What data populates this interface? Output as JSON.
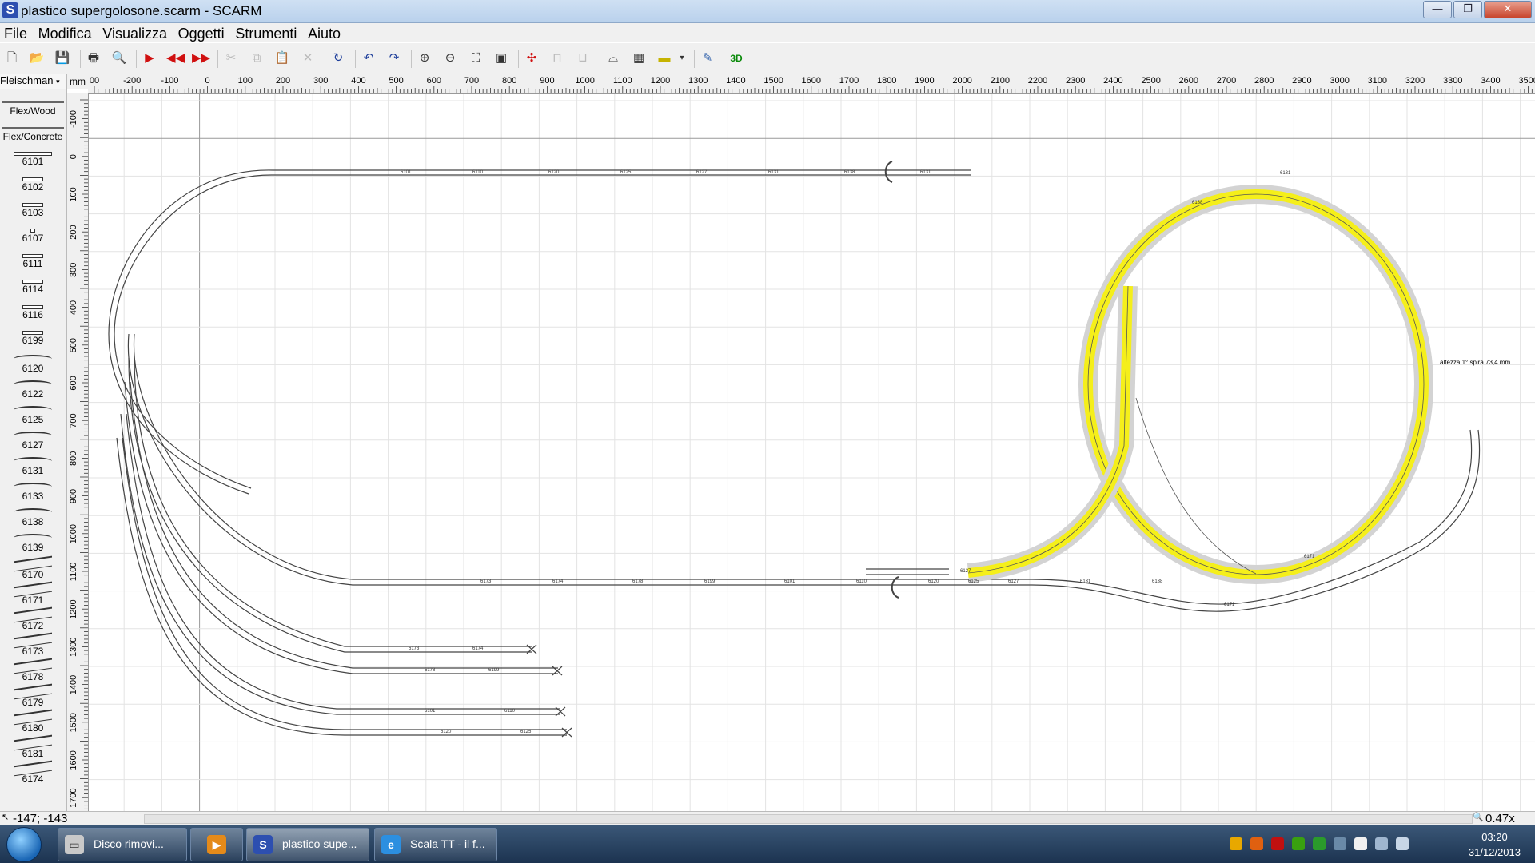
{
  "window": {
    "title": "plastico supergolosone.scarm - SCARM",
    "app_icon": "S",
    "minimize": "—",
    "maximize": "❐",
    "close": "✕"
  },
  "menu": [
    "File",
    "Modifica",
    "Visualizza",
    "Oggetti",
    "Strumenti",
    "Aiuto"
  ],
  "toolbar": {
    "icons": [
      "new-file-icon",
      "open-folder-icon",
      "save-icon",
      "print-icon",
      "print-preview-icon",
      "play-icon",
      "rewind-icon",
      "fast-forward-icon",
      "cut-icon",
      "copy-icon",
      "paste-icon",
      "delete-icon",
      "rotate-icon",
      "undo-icon",
      "redo-icon",
      "zoom-in-icon",
      "zoom-out-icon",
      "zoom-fit-icon",
      "zoom-100-icon",
      "track-split-icon",
      "track-join-icon",
      "track-flip-icon",
      "bridge-icon",
      "tunnel-icon",
      "layer-icon",
      "measure-icon",
      "3d-view-icon"
    ],
    "label_3d": "3D"
  },
  "palette": {
    "library": "Fleischman",
    "categories": [
      "Flex/Wood",
      "Flex/Concrete"
    ],
    "items": [
      "6101",
      "6102",
      "6103",
      "6107",
      "6111",
      "6114",
      "6116",
      "6199",
      "6120",
      "6122",
      "6125",
      "6127",
      "6131",
      "6133",
      "6138",
      "6139",
      "6170",
      "6171",
      "6172",
      "6173",
      "6178",
      "6179",
      "6180",
      "6181",
      "6174"
    ]
  },
  "ruler": {
    "unit": "mm",
    "h_labels": [
      "00",
      "-200",
      "-100",
      "0",
      "100",
      "200",
      "300",
      "400",
      "500",
      "600",
      "700",
      "800",
      "900",
      "1000",
      "1100",
      "1200",
      "1300",
      "1400",
      "1500",
      "1600",
      "1700",
      "1800",
      "1900",
      "2000",
      "2100",
      "2200",
      "2300",
      "2400",
      "2500",
      "2600",
      "2700",
      "2800",
      "2900",
      "3000",
      "3100",
      "3200",
      "3300",
      "3400",
      "3500"
    ],
    "v_labels": [
      "-100",
      "0",
      "100",
      "200",
      "300",
      "400",
      "500",
      "600",
      "700",
      "800",
      "900",
      "1000",
      "1100",
      "1200",
      "1300",
      "1400",
      "1500",
      "1600",
      "1700"
    ]
  },
  "canvas": {
    "annotation": "altezza 1° spira 73,4 mm",
    "track_labels": [
      "6101",
      "6110",
      "6120",
      "6125",
      "6127",
      "6131",
      "6138",
      "6171",
      "6173",
      "6174",
      "6178",
      "6199"
    ],
    "highlight_color": "#f5ef1a"
  },
  "status": {
    "coords": "-147; -143",
    "zoom": "0.47x"
  },
  "taskbar": {
    "tasks": [
      "Disco rimovi...",
      "",
      "plastico supe...",
      "Scala TT - il f..."
    ],
    "time": "03:20",
    "date": "31/12/2013"
  }
}
